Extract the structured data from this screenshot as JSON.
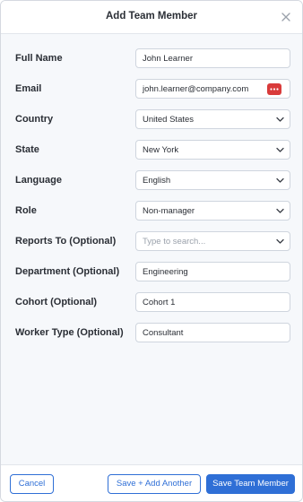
{
  "modal": {
    "title": "Add Team Member",
    "close_icon": "close-icon"
  },
  "fields": {
    "full_name": {
      "label": "Full Name",
      "value": "John Learner"
    },
    "email": {
      "label": "Email",
      "value": "john.learner@company.com",
      "icon": "password-manager-icon"
    },
    "country": {
      "label": "Country",
      "value": "United States"
    },
    "state": {
      "label": "State",
      "value": "New York"
    },
    "language": {
      "label": "Language",
      "value": "English"
    },
    "role": {
      "label": "Role",
      "value": "Non-manager"
    },
    "reports_to": {
      "label": "Reports To (Optional)",
      "placeholder": "Type to search..."
    },
    "department": {
      "label": "Department (Optional)",
      "value": "Engineering"
    },
    "cohort": {
      "label": "Cohort (Optional)",
      "value": "Cohort 1"
    },
    "worker_type": {
      "label": "Worker Type (Optional)",
      "value": "Consultant"
    }
  },
  "footer": {
    "cancel_label": "Cancel",
    "save_add_another_label": "Save + Add Another",
    "save_label": "Save Team Member"
  },
  "colors": {
    "accent": "#2f6fd6",
    "password_icon": "#d93b3b"
  }
}
